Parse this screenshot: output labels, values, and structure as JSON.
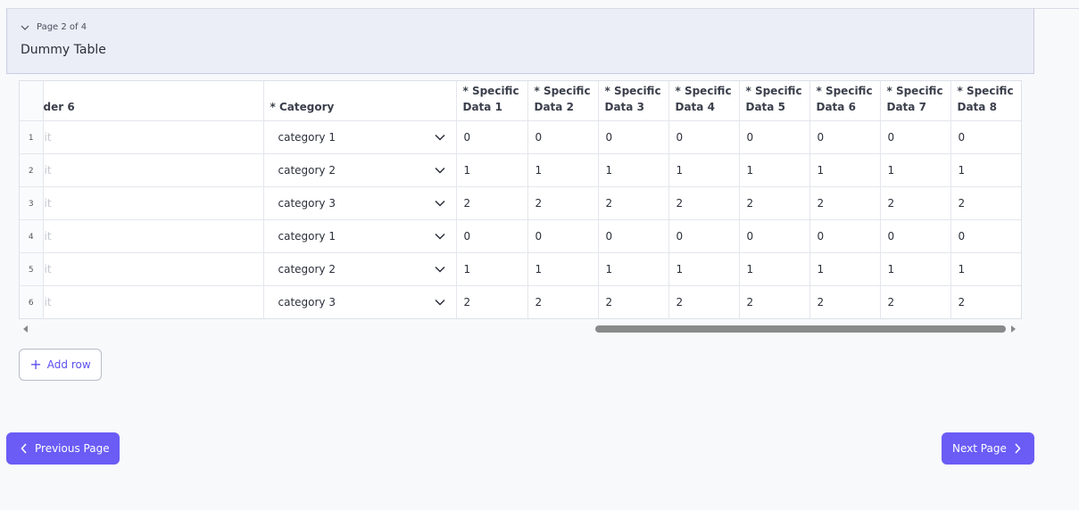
{
  "section": {
    "page_indicator": "Page 2 of 4",
    "title": "Dummy Table"
  },
  "table": {
    "columns": [
      "der 6",
      "* Category",
      "* Specific Data 1",
      "* Specific Data 2",
      "* Specific Data 3",
      "* Specific Data 4",
      "* Specific Data 5",
      "* Specific Data 6",
      "* Specific Data 7",
      "* Specific Data 8"
    ],
    "col_lines": [
      [
        "der 6"
      ],
      [
        "* Category"
      ],
      [
        "* Specific",
        "Data 1"
      ],
      [
        "* Specific",
        "Data 2"
      ],
      [
        "* Specific",
        "Data 3"
      ],
      [
        "* Specific",
        "Data 4"
      ],
      [
        "* Specific",
        "Data 5"
      ],
      [
        "* Specific",
        "Data 6"
      ],
      [
        "* Specific",
        "Data 7"
      ],
      [
        "* Specific",
        "Data 8"
      ]
    ],
    "rows": [
      {
        "num": "1",
        "header6": "it",
        "category": "category 1",
        "values": [
          "0",
          "0",
          "0",
          "0",
          "0",
          "0",
          "0",
          "0"
        ]
      },
      {
        "num": "2",
        "header6": "it",
        "category": "category 2",
        "values": [
          "1",
          "1",
          "1",
          "1",
          "1",
          "1",
          "1",
          "1"
        ]
      },
      {
        "num": "3",
        "header6": "it",
        "category": "category 3",
        "values": [
          "2",
          "2",
          "2",
          "2",
          "2",
          "2",
          "2",
          "2"
        ]
      },
      {
        "num": "4",
        "header6": "it",
        "category": "category 1",
        "values": [
          "0",
          "0",
          "0",
          "0",
          "0",
          "0",
          "0",
          "0"
        ]
      },
      {
        "num": "5",
        "header6": "it",
        "category": "category 2",
        "values": [
          "1",
          "1",
          "1",
          "1",
          "1",
          "1",
          "1",
          "1"
        ]
      },
      {
        "num": "6",
        "header6": "it",
        "category": "category 3",
        "values": [
          "2",
          "2",
          "2",
          "2",
          "2",
          "2",
          "2",
          "2"
        ]
      }
    ]
  },
  "actions": {
    "add_row": "Add row",
    "previous": "Previous Page",
    "next": "Next Page"
  },
  "icons": {
    "collapse": "chevron-down-icon",
    "dropdown": "chevron-down-icon",
    "add": "plus-icon",
    "prev": "chevron-left-icon",
    "next": "chevron-right-icon"
  },
  "colors": {
    "accent": "#6a5cf5",
    "header_bg": "#ebedf7"
  }
}
